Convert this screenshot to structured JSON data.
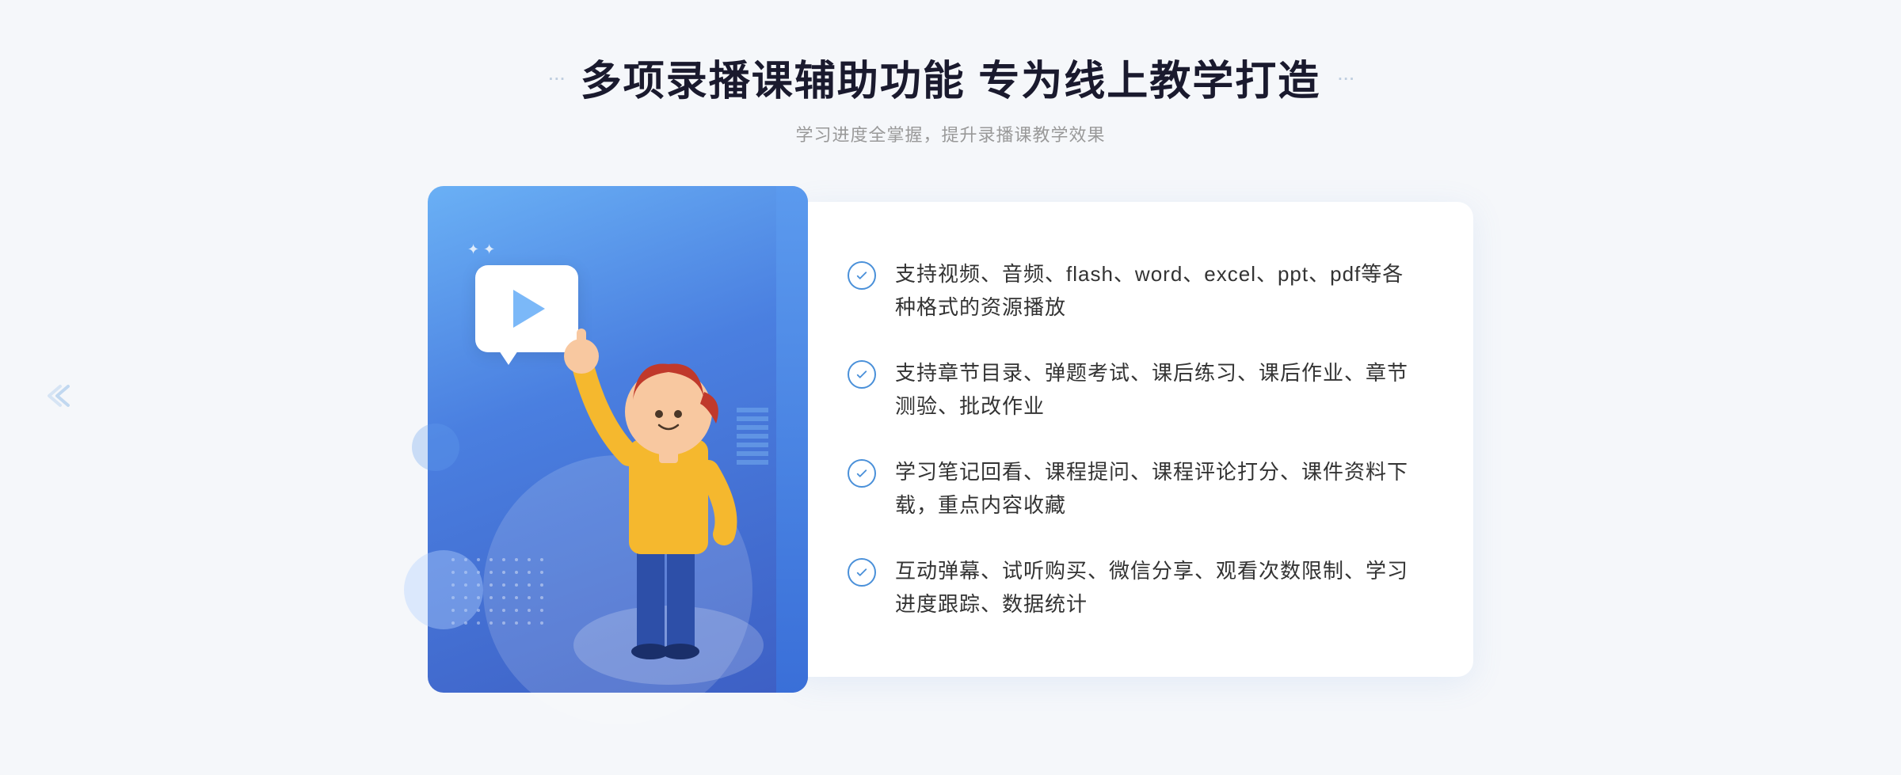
{
  "header": {
    "decorator_left": "···",
    "decorator_right": "···",
    "title": "多项录播课辅助功能 专为线上教学打造",
    "subtitle": "学习进度全掌握，提升录播课教学效果"
  },
  "features": [
    {
      "id": "feature-1",
      "text": "支持视频、音频、flash、word、excel、ppt、pdf等各种格式的资源播放"
    },
    {
      "id": "feature-2",
      "text": "支持章节目录、弹题考试、课后练习、课后作业、章节测验、批改作业"
    },
    {
      "id": "feature-3",
      "text": "学习笔记回看、课程提问、课程评论打分、课件资料下载，重点内容收藏"
    },
    {
      "id": "feature-4",
      "text": "互动弹幕、试听购买、微信分享、观看次数限制、学习进度跟踪、数据统计"
    }
  ],
  "colors": {
    "primary": "#4a90d9",
    "gradient_start": "#6ab0f5",
    "gradient_end": "#3d5fc4",
    "text_dark": "#1a1a2e",
    "text_light": "#999999",
    "feature_text": "#333333",
    "bg": "#f5f7fa"
  }
}
